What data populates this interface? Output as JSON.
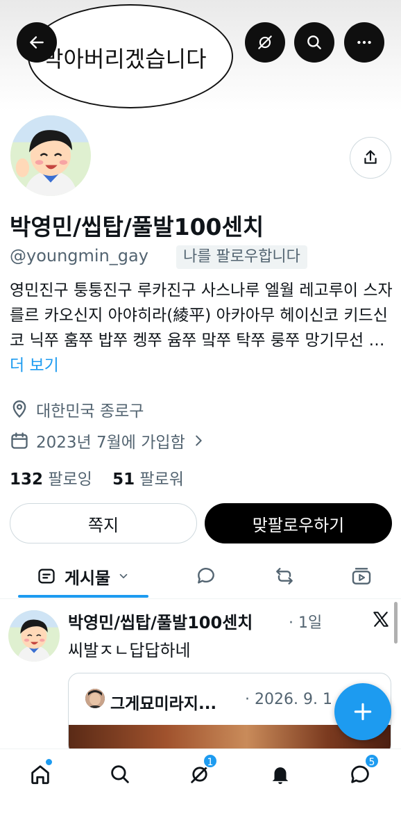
{
  "banner": {
    "bubble_text": "막아버리겠습니다"
  },
  "profile": {
    "display_name": "박영민/씹탑/풀발100센치",
    "handle": "@youngmin_gay",
    "follows_you": "나를 팔로우합니다",
    "bio": "영민진구 퉁퉁진구 루카진구 사스나루 엘월 레고루이 스자를르 카오신지 아야히라(綾平) 아카아무 헤이신코 키드신코 닉쭈 훔쭈 밥쭈 켕쭈 윰쭈 맠쭈 탁쭈 룽쭈 망기무선 …",
    "bio_more": " 더 보기",
    "location": "대한민국 종로구",
    "joined": "2023년 7월에 가입함",
    "following_count": "132",
    "following_label": "팔로잉",
    "followers_count": "51",
    "followers_label": "팔로워",
    "message_button": "쪽지",
    "follow_button": "맞팔로우하기"
  },
  "tabs": [
    {
      "label": "게시물",
      "icon": "posts-icon",
      "active": true
    },
    {
      "label": "",
      "icon": "reply-icon"
    },
    {
      "label": "",
      "icon": "repost-icon"
    },
    {
      "label": "",
      "icon": "media-icon"
    }
  ],
  "post": {
    "author": "박영민/씹탑/풀발100센치",
    "time": "· 1일",
    "text": "씨발ㅈㄴ답답하네",
    "quote": {
      "author": "그게묘미라지...",
      "date": "· 2026. 9. 1"
    }
  },
  "nav": {
    "grok_badge": "1",
    "messages_badge": "5"
  },
  "colors": {
    "accent": "#1d9bf0",
    "text": "#0f1419",
    "muted": "#536471"
  }
}
